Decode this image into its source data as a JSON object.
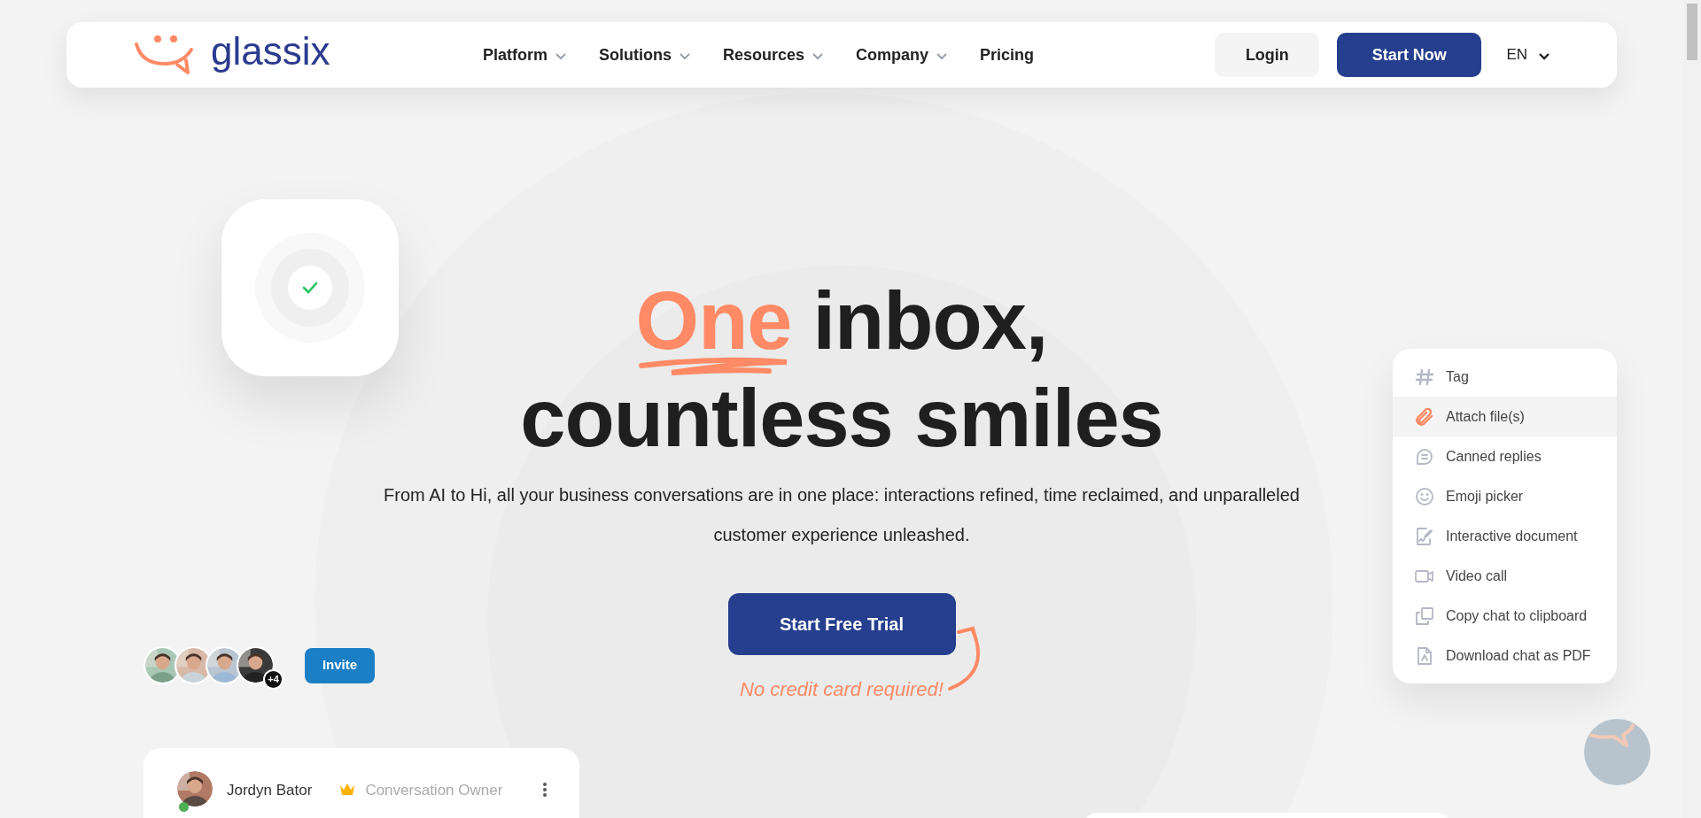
{
  "header": {
    "logo": "glassix",
    "nav": [
      {
        "label": "Platform",
        "dropdown": true
      },
      {
        "label": "Solutions",
        "dropdown": true
      },
      {
        "label": "Resources",
        "dropdown": true
      },
      {
        "label": "Company",
        "dropdown": true
      },
      {
        "label": "Pricing",
        "dropdown": false
      }
    ],
    "login": "Login",
    "cta": "Start Now",
    "language": "EN"
  },
  "hero": {
    "highlight": "One",
    "title_rest": "inbox,",
    "title_line2": "countless smiles",
    "subtitle": "From AI to Hi, all your business conversations are in one place: interactions refined, time reclaimed, and unparalleled customer experience unleashed.",
    "cta": "Start Free Trial",
    "note": "No credit card required!"
  },
  "team": {
    "more": "+4",
    "invite": "Invite"
  },
  "participant": {
    "name": "Jordyn Bator",
    "role": "Conversation Owner",
    "online": true
  },
  "actions": [
    {
      "kind": "tag",
      "label": "Tag",
      "selected": false
    },
    {
      "kind": "attach",
      "label": "Attach file(s)",
      "selected": true
    },
    {
      "kind": "canned",
      "label": "Canned replies",
      "selected": false
    },
    {
      "kind": "emoji",
      "label": "Emoji picker",
      "selected": false
    },
    {
      "kind": "document",
      "label": "Interactive document",
      "selected": false
    },
    {
      "kind": "video",
      "label": "Video call",
      "selected": false
    },
    {
      "kind": "copy",
      "label": "Copy chat to clipboard",
      "selected": false
    },
    {
      "kind": "pdf",
      "label": "Download chat as PDF",
      "selected": false
    }
  ]
}
